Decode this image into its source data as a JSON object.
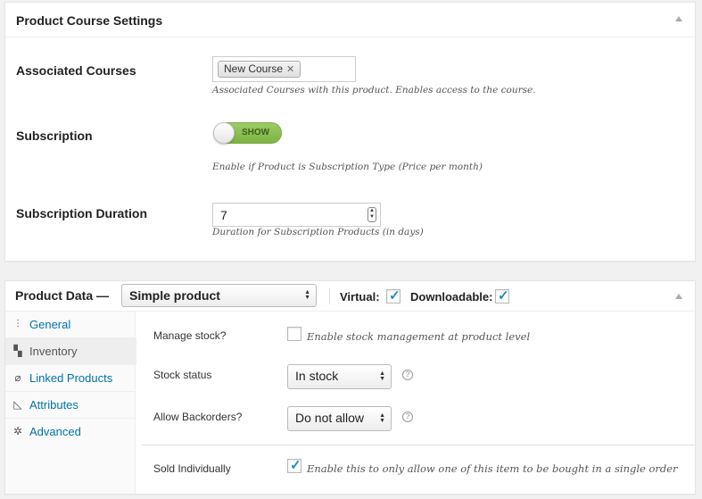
{
  "course_box": {
    "title": "Product Course Settings",
    "associated_courses": {
      "label": "Associated Courses",
      "tag": "New Course",
      "tag_remove": "✕",
      "description": "Associated Courses with this product. Enables access to the course."
    },
    "subscription": {
      "label": "Subscription",
      "toggle_text": "SHOW",
      "description": "Enable if Product is Subscription Type (Price per month)"
    },
    "duration": {
      "label": "Subscription Duration",
      "value": "7",
      "description": "Duration for Subscription Products (in days)"
    }
  },
  "product_data": {
    "title": "Product Data —",
    "type_select": "Simple product",
    "virtual_label": "Virtual:",
    "virtual_checked": true,
    "downloadable_label": "Downloadable:",
    "downloadable_checked": true,
    "tabs": [
      {
        "label": "General",
        "icon": "sliders-icon"
      },
      {
        "label": "Inventory",
        "icon": "boxes-icon"
      },
      {
        "label": "Linked Products",
        "icon": "link-icon"
      },
      {
        "label": "Attributes",
        "icon": "ruler-icon"
      },
      {
        "label": "Advanced",
        "icon": "gear-icon"
      }
    ],
    "active_tab": "Inventory",
    "inventory": {
      "manage_stock_label": "Manage stock?",
      "manage_stock_desc": "Enable stock management at product level",
      "manage_stock_checked": false,
      "stock_status_label": "Stock status",
      "stock_status_value": "In stock",
      "backorders_label": "Allow Backorders?",
      "backorders_value": "Do not allow",
      "sold_individually_label": "Sold Individually",
      "sold_individually_desc": "Enable this to only allow one of this item to be bought in a single order",
      "sold_individually_checked": true
    }
  },
  "colors": {
    "link": "#0073aa",
    "toggle_on": "#8bc34a",
    "check": "#1e8cbe"
  }
}
